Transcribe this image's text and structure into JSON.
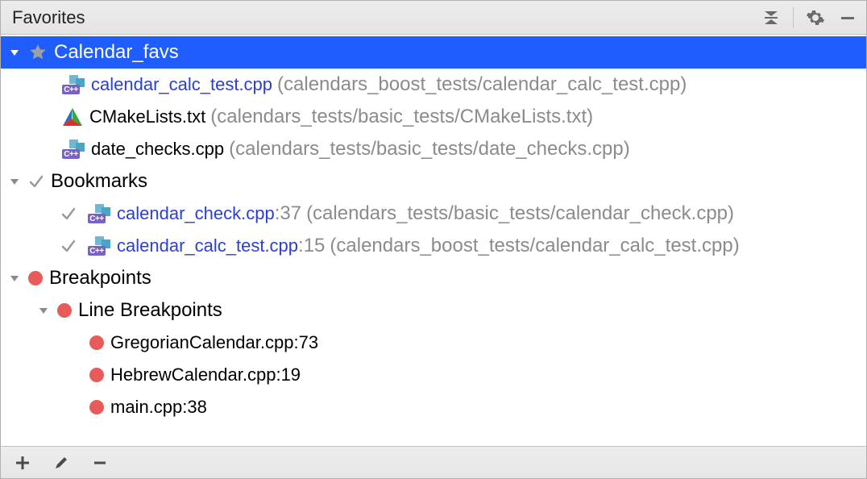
{
  "header": {
    "title": "Favorites"
  },
  "tree": {
    "favs": {
      "label": "Calendar_favs",
      "items": [
        {
          "name": "calendar_calc_test.cpp",
          "path": "(calendars_boost_tests/calendar_calc_test.cpp)"
        },
        {
          "name": "CMakeLists.txt",
          "path": "(calendars_tests/basic_tests/CMakeLists.txt)"
        },
        {
          "name": "date_checks.cpp",
          "path": "(calendars_tests/basic_tests/date_checks.cpp)"
        }
      ]
    },
    "bookmarks": {
      "label": "Bookmarks",
      "items": [
        {
          "name": "calendar_check.cpp",
          "line": ":37",
          "path": "(calendars_tests/basic_tests/calendar_check.cpp)"
        },
        {
          "name": "calendar_calc_test.cpp",
          "line": ":15",
          "path": "(calendars_boost_tests/calendar_calc_test.cpp)"
        }
      ]
    },
    "breakpoints": {
      "label": "Breakpoints",
      "sub": {
        "label": "Line Breakpoints",
        "items": [
          {
            "name": "GregorianCalendar.cpp:73"
          },
          {
            "name": "HebrewCalendar.cpp:19"
          },
          {
            "name": "main.cpp:38"
          }
        ]
      }
    }
  }
}
